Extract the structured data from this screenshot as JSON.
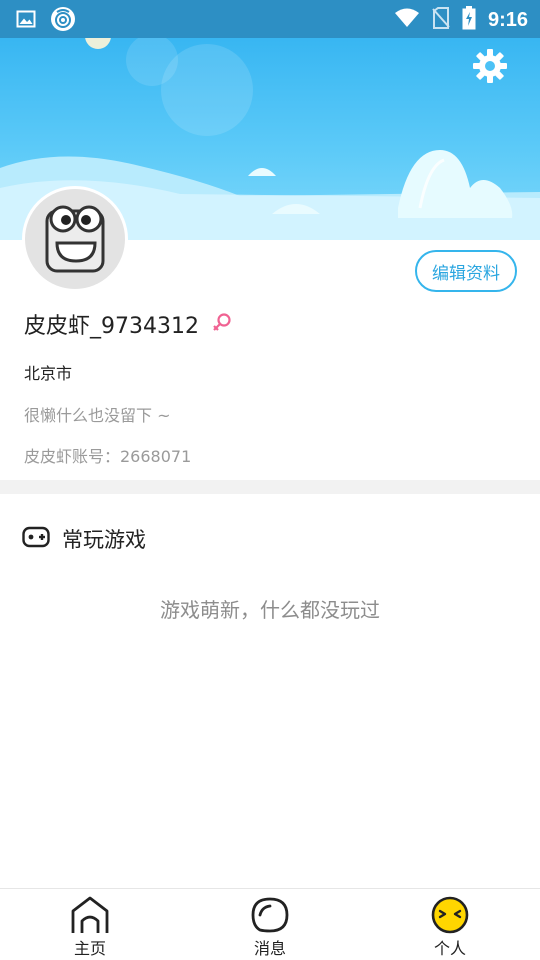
{
  "status_bar": {
    "time": "9:16",
    "icons": [
      "image-icon",
      "app-notification-icon",
      "wifi-icon",
      "no-sim-icon",
      "battery-charging-icon"
    ]
  },
  "header": {
    "settings_icon": "gear-icon",
    "banner_colors": [
      "#38b6f2",
      "#7fd9fb"
    ]
  },
  "profile": {
    "edit_label": "编辑资料",
    "username": "皮皮虾_9734312",
    "gender_icon": "female-icon",
    "city": "北京市",
    "bio": "很懒什么也没留下 ~",
    "account": "皮皮虾账号：2668071"
  },
  "games_section": {
    "icon": "gamepad-icon",
    "title": "常玩游戏",
    "empty_message": "游戏萌新，什么都没玩过"
  },
  "bottom_nav": {
    "items": [
      {
        "label": "主页",
        "icon": "home-icon"
      },
      {
        "label": "消息",
        "icon": "message-icon"
      },
      {
        "label": "个人",
        "icon": "profile-face-icon"
      }
    ]
  },
  "colors": {
    "accent": "#35b5ec",
    "status_bar": "#2d8fc4",
    "gender": "#f06292",
    "profile_active": "#ffd600"
  }
}
